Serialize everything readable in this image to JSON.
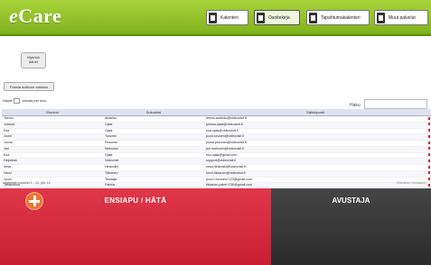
{
  "brand": {
    "prefix": "e",
    "name": "Care"
  },
  "nav": [
    {
      "label": "Kalenteri",
      "icon": "calendar-icon"
    },
    {
      "label": "Osoitekirja",
      "icon": "addressbook-icon",
      "active": true
    },
    {
      "label": "Tapahtumakalenteri",
      "icon": "event-calendar-icon"
    },
    {
      "label": "Muut palvelut",
      "icon": "services-icon"
    }
  ],
  "toolbar": {
    "own_button": [
      "Mykistä",
      "äänet"
    ],
    "empty_button": "Paksta soittoon vastaus",
    "show_prefix": "Näytä",
    "show_suffix": "tulosta per sivu",
    "search_label": "Haku"
  },
  "table": {
    "headers": [
      "Etunimi",
      "Sukunimi",
      "Sähköposti"
    ],
    "rows": [
      [
        "Teemu",
        "Aulanko",
        "teemu.aulanko@videovisit.fi"
      ],
      [
        "Juhana",
        "Ojala",
        "juhana.ojala@videovisit.fi"
      ],
      [
        "Esa",
        "Ojala",
        "esa.ojala@videovisit.fi"
      ],
      [
        "Jouni",
        "Turunen",
        "jouni.turunen@videovisit.fi"
      ],
      [
        "Joona",
        "Pesonen",
        "joona.pesonen@videovisit.fi"
      ],
      [
        "Jari",
        "Mahonen",
        "jari.mahonen@videovisit.fi"
      ],
      [
        "Esa",
        "Ojala",
        "eko.ojala@gmail.com"
      ],
      [
        "Helpdesk",
        "Videovisit",
        "support@videovisit.fi"
      ],
      [
        "Vesa",
        "Hirsimäki",
        "vesa.hirsimaki@videovisit.fi"
      ],
      [
        "Henri",
        "Tikkanen",
        "henri.tikkanen@videovisit.fi"
      ],
      [
        "Jouni",
        "Testaaja",
        "jouni.t.turunen+123@gmail.com"
      ],
      [
        "Testiluonus",
        "Palmia",
        "tikkanen.palmi+236@gmail.com"
      ]
    ]
  },
  "footer": {
    "info": "Näytetään tulokset 1 - 12, yht. 12",
    "nav": "‹ Edellinen Seuraava ›"
  },
  "bottom": {
    "sos_label": "ENSIAPU / HÄTÄ",
    "help_label": "AVUSTAJA"
  },
  "colors": {
    "header_green": "#8dc02a",
    "sos_red": "#d42b3e",
    "help_dark": "#363636",
    "plus_orange": "#ee7432",
    "delete_red": "#e21b2a"
  }
}
